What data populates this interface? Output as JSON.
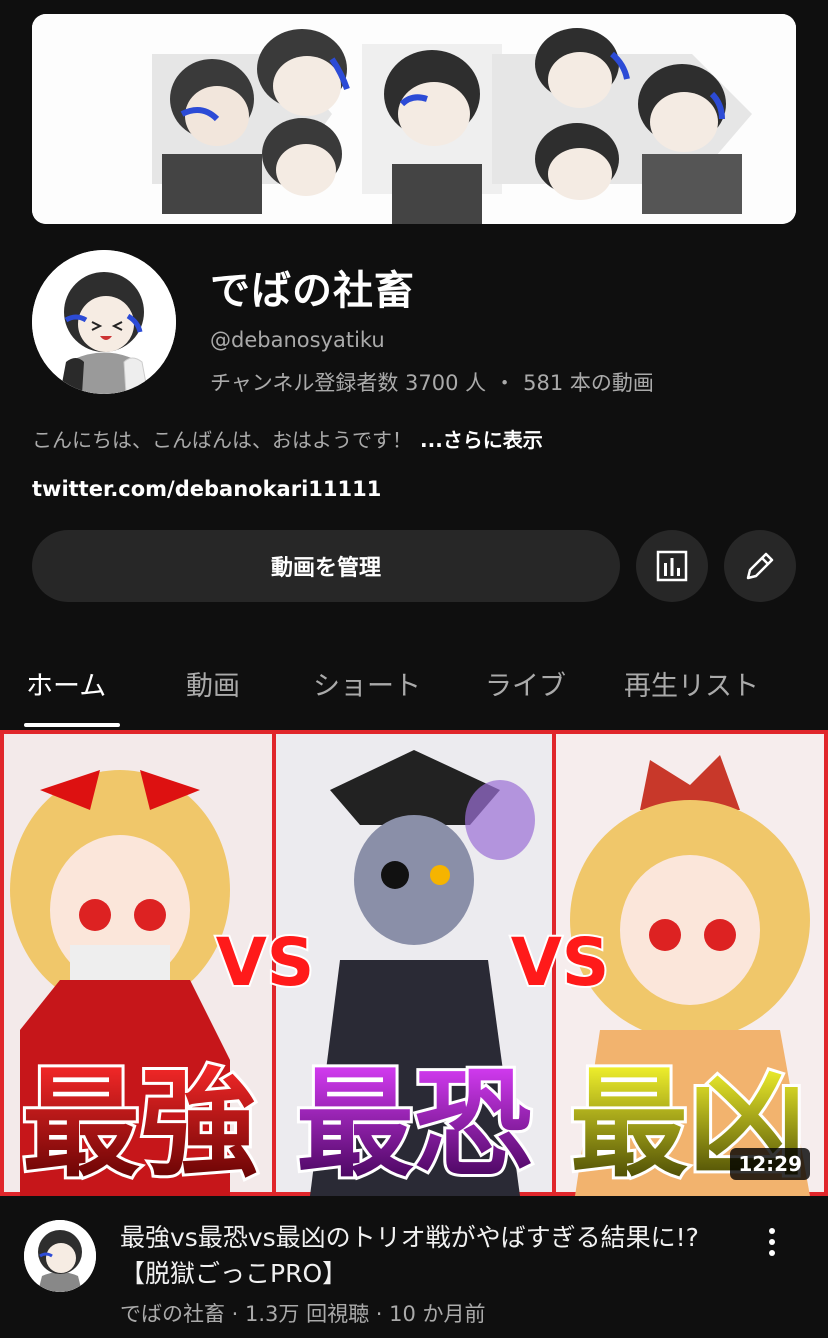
{
  "channel": {
    "name": "でばの社畜",
    "handle": "@debanosyatiku",
    "subscribers": "チャンネル登録者数 3700 人",
    "separator": "・",
    "video_count": "581 本の動画",
    "description": "こんにちは、こんばんは、おはようです！",
    "more": "...さらに表示",
    "link": "twitter.com/debanokari11111"
  },
  "actions": {
    "manage_label": "動画を管理",
    "stats_icon": "bar-chart-icon",
    "edit_icon": "pencil-icon"
  },
  "tabs": [
    {
      "label": "ホーム",
      "active": true
    },
    {
      "label": "動画",
      "active": false
    },
    {
      "label": "ショート",
      "active": false
    },
    {
      "label": "ライブ",
      "active": false
    },
    {
      "label": "再生リスト",
      "active": false
    }
  ],
  "thumbnail": {
    "vs_text": "VS",
    "word_left": "最強",
    "word_mid": "最恐",
    "word_right": "最凶",
    "duration": "12:29"
  },
  "video": {
    "title": "最強vs最恐vs最凶のトリオ戦がやばすぎる結果に!?【脱獄ごっこPRO】",
    "meta": "でばの社畜 · 1.3万 回視聴 · 10 か月前"
  },
  "colors": {
    "background": "#0f0f0f",
    "button_bg": "#272727",
    "secondary_text": "#aaaaaa",
    "thumbnail_border": "#e0262b"
  }
}
